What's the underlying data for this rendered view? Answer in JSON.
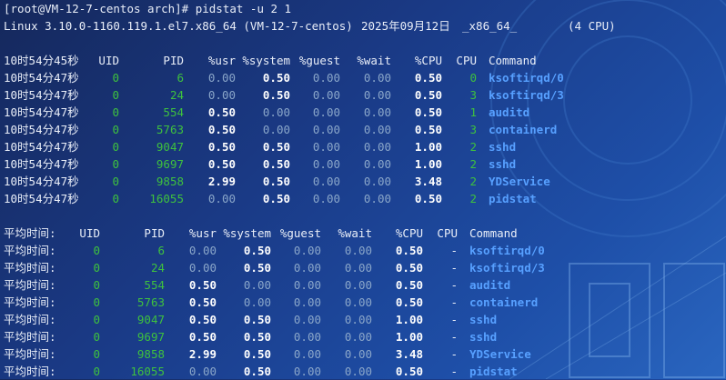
{
  "terminal": {
    "prompt": "[root@VM-12-7-centos arch]# pidstat -u 2 1",
    "sysinfo": {
      "kernel": "Linux 3.10.0-1160.119.1.el7.x86_64 (VM-12-7-centos)",
      "date": "2025年09月12日",
      "arch": "_x86_64_",
      "cpus": "(4 CPU)"
    },
    "table1": {
      "headers": [
        "10时54分45秒",
        "UID",
        "PID",
        "%usr",
        "%system",
        "%guest",
        "%wait",
        "%CPU",
        "CPU",
        "Command"
      ],
      "rows": [
        [
          "10时54分47秒",
          "0",
          "6",
          "0.00",
          "0.50",
          "0.00",
          "0.00",
          "0.50",
          "0",
          "ksoftirqd/0"
        ],
        [
          "10时54分47秒",
          "0",
          "24",
          "0.00",
          "0.50",
          "0.00",
          "0.00",
          "0.50",
          "3",
          "ksoftirqd/3"
        ],
        [
          "10时54分47秒",
          "0",
          "554",
          "0.50",
          "0.00",
          "0.00",
          "0.00",
          "0.50",
          "1",
          "auditd"
        ],
        [
          "10时54分47秒",
          "0",
          "5763",
          "0.50",
          "0.00",
          "0.00",
          "0.00",
          "0.50",
          "3",
          "containerd"
        ],
        [
          "10时54分47秒",
          "0",
          "9047",
          "0.50",
          "0.50",
          "0.00",
          "0.00",
          "1.00",
          "2",
          "sshd"
        ],
        [
          "10时54分47秒",
          "0",
          "9697",
          "0.50",
          "0.50",
          "0.00",
          "0.00",
          "1.00",
          "2",
          "sshd"
        ],
        [
          "10时54分47秒",
          "0",
          "9858",
          "2.99",
          "0.50",
          "0.00",
          "0.00",
          "3.48",
          "2",
          "YDService"
        ],
        [
          "10时54分47秒",
          "0",
          "16055",
          "0.00",
          "0.50",
          "0.00",
          "0.00",
          "0.50",
          "2",
          "pidstat"
        ]
      ]
    },
    "table2": {
      "headers": [
        "平均时间:",
        "UID",
        "PID",
        "%usr",
        "%system",
        "%guest",
        "%wait",
        "%CPU",
        "CPU",
        "Command"
      ],
      "rows": [
        [
          "平均时间:",
          "0",
          "6",
          "0.00",
          "0.50",
          "0.00",
          "0.00",
          "0.50",
          "-",
          "ksoftirqd/0"
        ],
        [
          "平均时间:",
          "0",
          "24",
          "0.00",
          "0.50",
          "0.00",
          "0.00",
          "0.50",
          "-",
          "ksoftirqd/3"
        ],
        [
          "平均时间:",
          "0",
          "554",
          "0.50",
          "0.00",
          "0.00",
          "0.00",
          "0.50",
          "-",
          "auditd"
        ],
        [
          "平均时间:",
          "0",
          "5763",
          "0.50",
          "0.00",
          "0.00",
          "0.00",
          "0.50",
          "-",
          "containerd"
        ],
        [
          "平均时间:",
          "0",
          "9047",
          "0.50",
          "0.50",
          "0.00",
          "0.00",
          "1.00",
          "-",
          "sshd"
        ],
        [
          "平均时间:",
          "0",
          "9697",
          "0.50",
          "0.50",
          "0.00",
          "0.00",
          "1.00",
          "-",
          "sshd"
        ],
        [
          "平均时间:",
          "0",
          "9858",
          "2.99",
          "0.50",
          "0.00",
          "0.00",
          "3.48",
          "-",
          "YDService"
        ],
        [
          "平均时间:",
          "0",
          "16055",
          "0.00",
          "0.50",
          "0.00",
          "0.00",
          "0.50",
          "-",
          "pidstat"
        ]
      ]
    },
    "colors": {
      "background": "#1a3a86",
      "text": "#e9eef8",
      "uid_pid": "#3ec13e",
      "zero_value": "#8aa6c9",
      "nonzero_value": "#ffffff",
      "command": "#57a0ff"
    }
  }
}
